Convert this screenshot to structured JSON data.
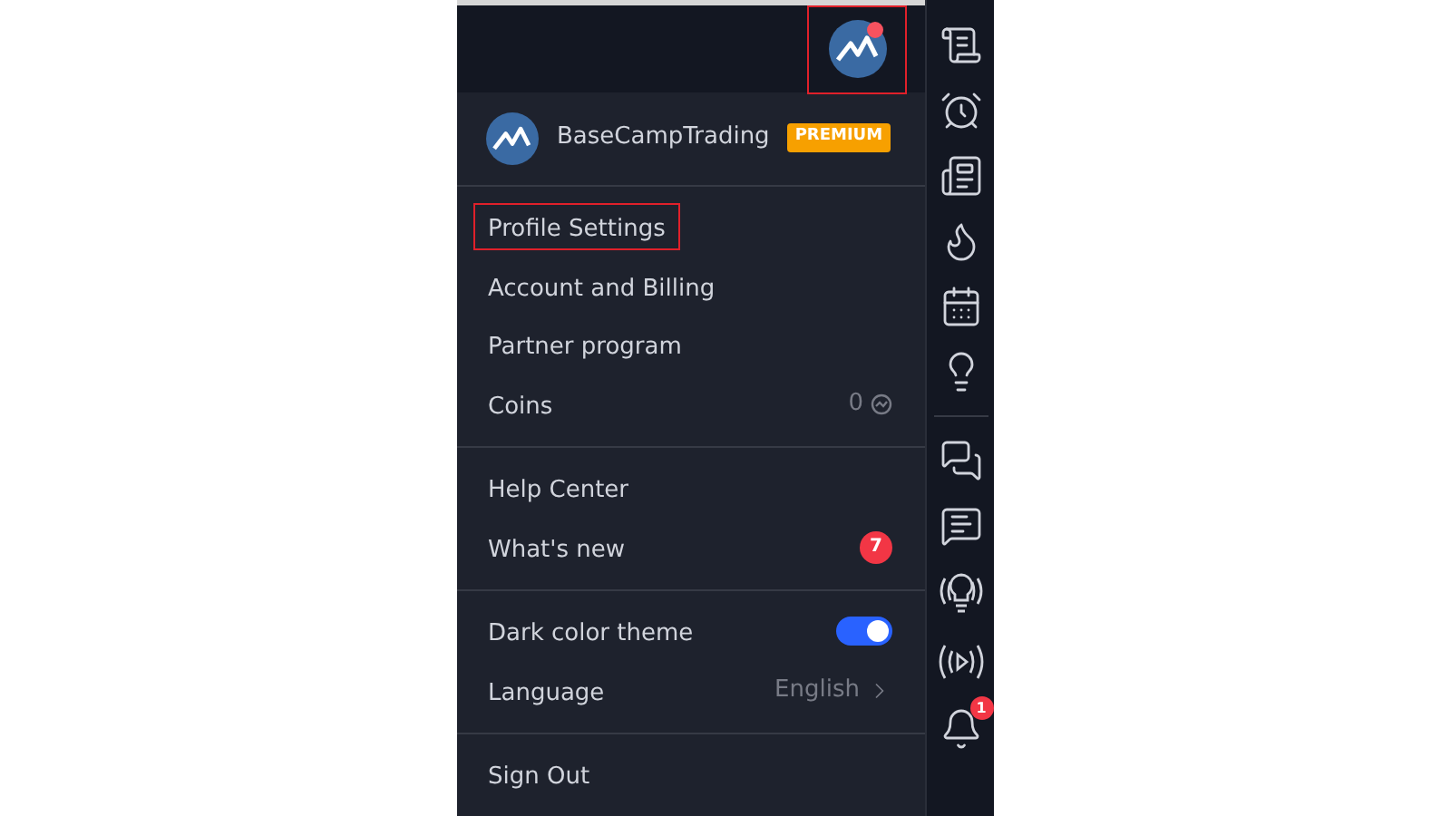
{
  "header": {
    "avatar_notification": true,
    "highlighted": true
  },
  "user": {
    "name": "BaseCampTrading",
    "badge": "PREMIUM"
  },
  "sections": [
    [
      {
        "kind": "link",
        "label": "Profile Settings",
        "highlighted": true
      },
      {
        "kind": "link",
        "label": "Account and Billing",
        "highlighted": false
      },
      {
        "kind": "link",
        "label": "Partner program",
        "highlighted": false
      },
      {
        "kind": "coins",
        "label": "Coins",
        "value": "0",
        "highlighted": false
      }
    ],
    [
      {
        "kind": "link",
        "label": "Help Center",
        "highlighted": false
      },
      {
        "kind": "badge",
        "label": "What's new",
        "count": "7",
        "highlighted": false
      }
    ],
    [
      {
        "kind": "toggle",
        "label": "Dark color theme",
        "on": true,
        "highlighted": false
      },
      {
        "kind": "select",
        "label": "Language",
        "value": "English",
        "highlighted": false
      }
    ],
    [
      {
        "kind": "link",
        "label": "Sign Out",
        "highlighted": false
      }
    ]
  ],
  "rail": [
    {
      "kind": "list"
    },
    {
      "kind": "alarm"
    },
    {
      "kind": "news"
    },
    {
      "kind": "flame"
    },
    {
      "kind": "calendar"
    },
    {
      "kind": "bulb"
    },
    {
      "kind": "divider"
    },
    {
      "kind": "chats"
    },
    {
      "kind": "chat"
    },
    {
      "kind": "bulb-signal"
    },
    {
      "kind": "play-signal"
    },
    {
      "kind": "bell",
      "badge": "1"
    }
  ]
}
